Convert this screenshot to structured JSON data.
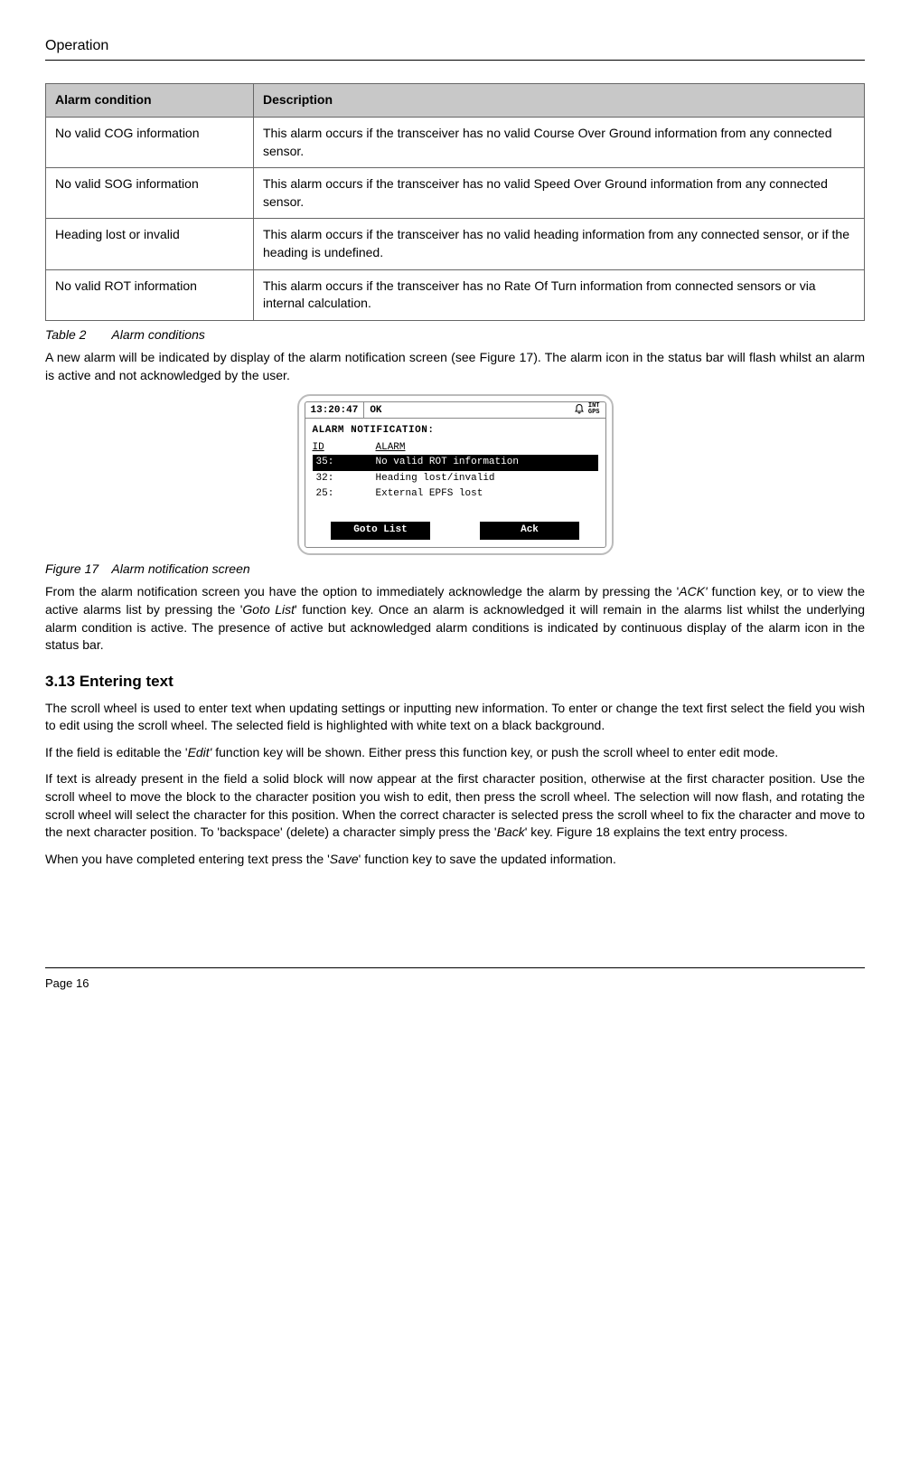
{
  "header": {
    "title": "Operation"
  },
  "table": {
    "headers": [
      "Alarm condition",
      "Description"
    ],
    "rows": [
      {
        "cond": "No valid COG information",
        "desc": "This alarm occurs if the transceiver has no valid Course Over Ground information from any connected sensor."
      },
      {
        "cond": "No valid SOG information",
        "desc": "This alarm occurs if the transceiver has no valid Speed Over Ground information from any connected sensor."
      },
      {
        "cond": "Heading lost or invalid",
        "desc": "This alarm occurs if the transceiver has no valid heading information from any connected sensor, or if the heading is undefined."
      },
      {
        "cond": "No valid ROT information",
        "desc": "This alarm occurs if the transceiver has no Rate Of Turn information from connected sensors or via internal calculation."
      }
    ]
  },
  "table_caption_label": "Table 2",
  "table_caption_text": "Alarm conditions",
  "para1": "A new alarm will be indicated by display of the alarm notification screen (see Figure 17). The alarm icon in the status bar will flash whilst an alarm is active and not acknowledged by the user.",
  "device": {
    "time": "13:20:47",
    "status": "OK",
    "gps_top": "INT",
    "gps_bottom": "GPS",
    "screen_title": "ALARM NOTIFICATION:",
    "head_id": "ID",
    "head_alarm": "ALARM",
    "rows": [
      {
        "id": "35:",
        "alarm": "No valid ROT information",
        "hl": true
      },
      {
        "id": "32:",
        "alarm": "Heading lost/invalid",
        "hl": false
      },
      {
        "id": "25:",
        "alarm": "External EPFS lost",
        "hl": false
      }
    ],
    "fn_left": "Goto List",
    "fn_right": "Ack"
  },
  "fig_caption_label": "Figure 17",
  "fig_caption_text": "Alarm notification screen",
  "para2_pre": "From the alarm notification screen you have the option to immediately acknowledge the alarm by pressing the '",
  "para2_ack": "ACK'",
  "para2_mid": " function key, or to view the active alarms list by pressing the '",
  "para2_goto": "Goto List",
  "para2_post": "' function key. Once an alarm is acknowledged it will remain in the alarms list whilst the underlying alarm condition is active. The presence of active but acknowledged alarm conditions is indicated by continuous display of the alarm icon in the status bar.",
  "section_num": "3.13",
  "section_title": "Entering text",
  "para3": "The scroll wheel is used to enter text when updating settings or inputting new information. To enter or change the text first select the field you wish to edit using the scroll wheel. The selected field is highlighted with white text on a black background.",
  "para4_pre": "If the field is editable the '",
  "para4_edit": "Edit'",
  "para4_post": " function key will be shown. Either press this function key, or push the scroll wheel to enter edit mode.",
  "para5_pre": "If text is already present in the field a solid block will now appear at the first character position, otherwise at the first character position. Use the scroll wheel to move the block to the character position you wish to edit, then press the scroll wheel. The selection will now flash, and rotating the scroll wheel will select the character for this position. When the correct character is selected press the scroll wheel to fix the character and move to the next character position. To 'backspace' (delete) a character simply press the '",
  "para5_back": "Back",
  "para5_post": "' key. Figure 18 explains the text entry process.",
  "para6_pre": "When you have completed entering text press the '",
  "para6_save": "Save",
  "para6_post": "' function key to save the updated information.",
  "footer": {
    "page": "Page 16"
  }
}
